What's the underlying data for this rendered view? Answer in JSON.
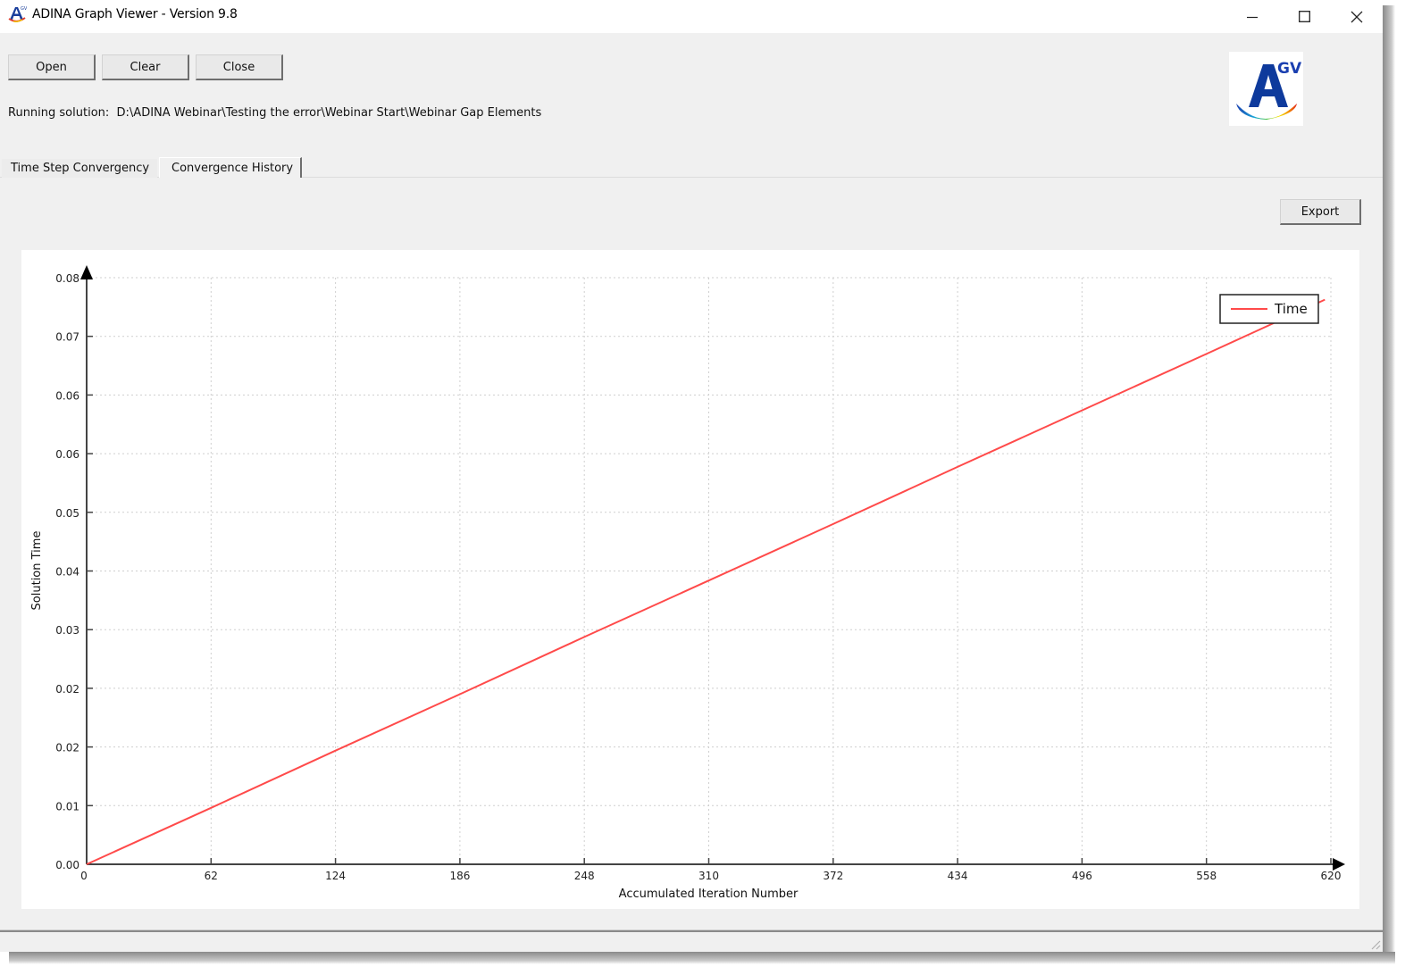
{
  "window": {
    "title": "ADINA Graph Viewer - Version 9.8",
    "app_icon": "adina-graph-viewer-icon",
    "controls": {
      "minimize": "minimize-icon",
      "maximize": "maximize-icon",
      "close": "close-icon"
    }
  },
  "toolbar": {
    "open_label": "Open",
    "clear_label": "Clear",
    "close_label": "Close"
  },
  "running_solution": {
    "label": "Running solution:",
    "path": "D:\\ADINA Webinar\\Testing the error\\Webinar Start\\Webinar Gap Elements"
  },
  "logo": {
    "text": "A",
    "superscript": "GV"
  },
  "tabs": [
    {
      "label": "Time Step Convergency",
      "active": false
    },
    {
      "label": "Convergence History",
      "active": true
    }
  ],
  "export_label": "Export",
  "colors": {
    "series": "#ff4a4a",
    "axis": "#000000",
    "grid": "#cfcfcf",
    "window_bg": "#f0f0f0"
  },
  "chart_data": {
    "type": "line",
    "title": "",
    "xlabel": "Accumulated Iteration Number",
    "ylabel": "Solution Time",
    "xlim": [
      0,
      620
    ],
    "ylim": [
      0,
      0.08
    ],
    "x_ticks": [
      0,
      62,
      124,
      186,
      248,
      310,
      372,
      434,
      496,
      558,
      620
    ],
    "x_tick_labels": [
      "0",
      "62",
      "124",
      "186",
      "248",
      "310",
      "372",
      "434",
      "496",
      "558",
      "620"
    ],
    "y_ticks": [
      0,
      0.008,
      0.016,
      0.024,
      0.032,
      0.04,
      0.048,
      0.056,
      0.064,
      0.072,
      0.08
    ],
    "y_tick_labels": [
      "0.00",
      "0.01",
      "0.02",
      "0.02",
      "0.03",
      "0.04",
      "0.05",
      "0.06",
      "0.06",
      "0.07",
      "0.08"
    ],
    "grid": true,
    "legend_position": "top-right",
    "series": [
      {
        "name": "Time",
        "x": [
          0,
          62,
          124,
          186,
          248,
          310,
          372,
          434,
          496,
          558,
          617
        ],
        "y": [
          0.0,
          0.0077,
          0.0155,
          0.0232,
          0.031,
          0.0387,
          0.0464,
          0.0542,
          0.0619,
          0.0696,
          0.077
        ]
      }
    ]
  }
}
